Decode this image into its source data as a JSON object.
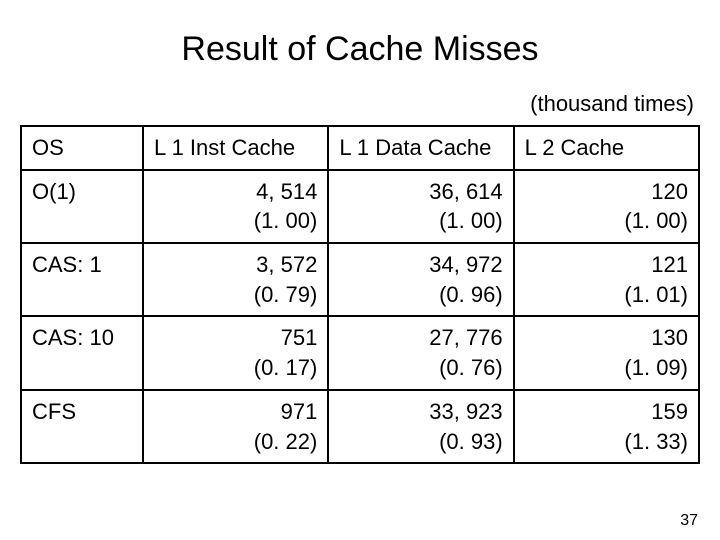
{
  "title": "Result of Cache Misses",
  "subtitle": "(thousand times)",
  "headers": {
    "os": "OS",
    "c1": "L 1 Inst Cache",
    "c2": "L 1 Data Cache",
    "c3": "L 2 Cache"
  },
  "rows": [
    {
      "os": "O(1)",
      "c1v": "4, 514",
      "c1r": "(1. 00)",
      "c2v": "36, 614",
      "c2r": "(1. 00)",
      "c3v": "120",
      "c3r": "(1. 00)"
    },
    {
      "os": "CAS: 1",
      "c1v": "3, 572",
      "c1r": "(0. 79)",
      "c2v": "34, 972",
      "c2r": "(0. 96)",
      "c3v": "121",
      "c3r": "(1. 01)"
    },
    {
      "os": "CAS: 10",
      "c1v": "751",
      "c1r": "(0. 17)",
      "c2v": "27, 776",
      "c2r": "(0. 76)",
      "c3v": "130",
      "c3r": "(1. 09)"
    },
    {
      "os": "CFS",
      "c1v": "971",
      "c1r": "(0. 22)",
      "c2v": "33, 923",
      "c2r": "(0. 93)",
      "c3v": "159",
      "c3r": "(1. 33)"
    }
  ],
  "page_number": "37",
  "chart_data": {
    "type": "table",
    "title": "Result of Cache Misses (thousand times)",
    "columns": [
      "OS",
      "L1 Inst Cache (value)",
      "L1 Inst Cache (ratio)",
      "L1 Data Cache (value)",
      "L1 Data Cache (ratio)",
      "L2 Cache (value)",
      "L2 Cache (ratio)"
    ],
    "rows": [
      [
        "O(1)",
        4514,
        1.0,
        36614,
        1.0,
        120,
        1.0
      ],
      [
        "CAS: 1",
        3572,
        0.79,
        34972,
        0.96,
        121,
        1.01
      ],
      [
        "CAS: 10",
        751,
        0.17,
        27776,
        0.76,
        130,
        1.09
      ],
      [
        "CFS",
        971,
        0.22,
        33923,
        0.93,
        159,
        1.33
      ]
    ]
  }
}
